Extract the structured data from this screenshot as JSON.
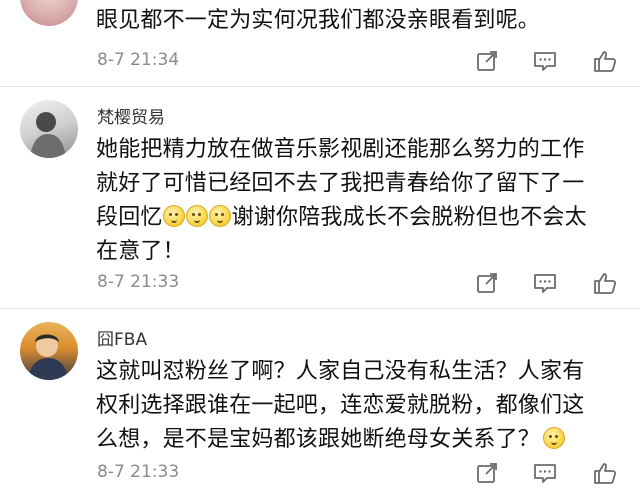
{
  "comments": [
    {
      "username": "",
      "text": "眼见都不一定为实何况我们都没亲眼看到呢。",
      "time": "8-7 21:34"
    },
    {
      "username": "梵樱贸易",
      "text_lines": [
        "她能把精力放在做音乐影视剧还能那么努力的工作",
        "就好了可惜已经回不去了我把青春给你了留下了一",
        "谢谢你陪我成长不会脱粉但也不会太",
        "在意了！"
      ],
      "line3_prefix": "段回忆",
      "time": "8-7 21:33"
    },
    {
      "username": "囧FBA",
      "text_lines": [
        "这就叫怼粉丝了啊？人家自己没有私生活？人家有",
        "权利选择跟谁在一起吧，连恋爱就脱粉，都像们这",
        "么想，是不是宝妈都该跟她断绝母女关系了？"
      ],
      "time": "8-7 21:33"
    }
  ],
  "icons": {
    "share": "share-icon",
    "comment": "comment-icon",
    "like": "thumbs-up-icon"
  }
}
